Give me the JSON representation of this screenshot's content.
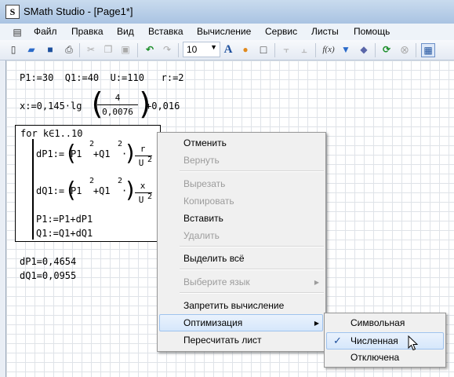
{
  "window": {
    "title": "SMath Studio - [Page1*]",
    "app_icon": "S"
  },
  "menu": [
    "Файл",
    "Правка",
    "Вид",
    "Вставка",
    "Вычисление",
    "Сервис",
    "Листы",
    "Помощь"
  ],
  "toolbar": {
    "font_size": "10",
    "fx": "f(x)"
  },
  "worksheet": {
    "line1": "P1:=30  Q1:=40  U:=110   r:=2",
    "x_left": "x:=0,145·lg",
    "x_num": "4",
    "x_den": "0,0076",
    "x_right": "+0,016",
    "for_head": "for k∈1..10",
    "dP1_left": "dP1:=",
    "dP1_mid": "P1  +Q1  ·",
    "dP1_num": "r",
    "dP1_den": "U",
    "dQ1_left": "dQ1:=",
    "dQ1_num": "x",
    "dQ1_den": "U",
    "exp": "2",
    "p1_update": "P1:=P1+dP1",
    "q1_update": "Q1:=Q1+dQ1",
    "result_dp1": "dP1=0,4654",
    "result_dq1": "dQ1=0,0955"
  },
  "context_menu": {
    "items": [
      {
        "label": "Отменить",
        "enabled": true
      },
      {
        "label": "Вернуть",
        "enabled": false
      },
      {
        "label": "Вырезать",
        "enabled": false
      },
      {
        "label": "Копировать",
        "enabled": false
      },
      {
        "label": "Вставить",
        "enabled": true
      },
      {
        "label": "Удалить",
        "enabled": false
      },
      {
        "label": "Выделить всё",
        "enabled": true
      },
      {
        "label": "Выберите язык",
        "enabled": false
      },
      {
        "label": "Запретить вычисление",
        "enabled": true
      },
      {
        "label": "Оптимизация",
        "enabled": true
      },
      {
        "label": "Пересчитать лист",
        "enabled": true
      }
    ]
  },
  "submenu": {
    "items": [
      {
        "label": "Символьная",
        "checked": false
      },
      {
        "label": "Численная",
        "checked": true
      },
      {
        "label": "Отключена",
        "checked": false
      }
    ],
    "check_mark": "✓"
  }
}
